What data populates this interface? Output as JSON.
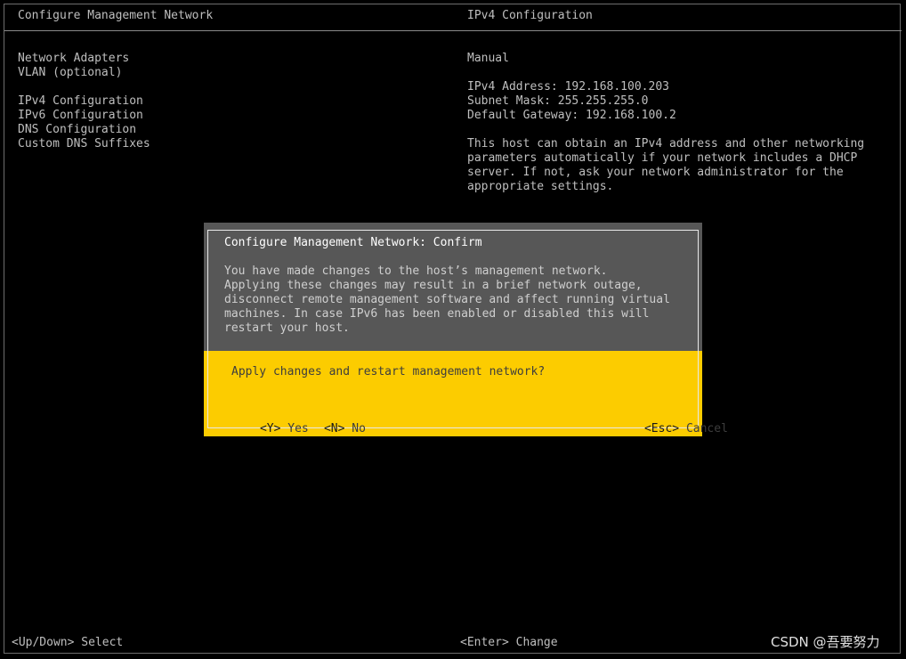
{
  "header": {
    "left_title": "Configure Management Network",
    "right_title": "IPv4 Configuration"
  },
  "menu": {
    "items": [
      {
        "label": "Network Adapters"
      },
      {
        "label": "VLAN (optional)"
      },
      {
        "label": "IPv4 Configuration"
      },
      {
        "label": "IPv6 Configuration"
      },
      {
        "label": "DNS Configuration"
      },
      {
        "label": "Custom DNS Suffixes"
      }
    ]
  },
  "info": {
    "mode": "Manual",
    "ipv4_address": "IPv4 Address: 192.168.100.203",
    "subnet_mask": "Subnet Mask: 255.255.255.0",
    "default_gateway": "Default Gateway: 192.168.100.2",
    "description": [
      "This host can obtain an IPv4 address and other networking",
      "parameters automatically if your network includes a DHCP",
      "server. If not, ask your network administrator for the",
      "appropriate settings."
    ]
  },
  "dialog": {
    "title": "Configure Management Network: Confirm",
    "body": [
      "You have made changes to the host’s management network.",
      "Applying these changes may result in a brief network outage,",
      "disconnect remote management software and affect running virtual",
      "machines. In case IPv6 has been enabled or disabled this will",
      "restart your host."
    ],
    "question": "Apply changes and restart management network?",
    "yes_key": "<Y>",
    "yes_label": "Yes",
    "no_key": "<N>",
    "no_label": "No",
    "cancel_key": "<Esc>",
    "cancel_label": "Cancel"
  },
  "footer": {
    "nav_key": "<Up/Down>",
    "nav_label": "Select",
    "enter_key": "<Enter>",
    "enter_label": "Change"
  },
  "watermark": "CSDN @吾要努力",
  "colors": {
    "background": "#000000",
    "text": "#bfbfbf",
    "dialog_gray": "#575757",
    "dialog_yellow": "#fccc00"
  }
}
